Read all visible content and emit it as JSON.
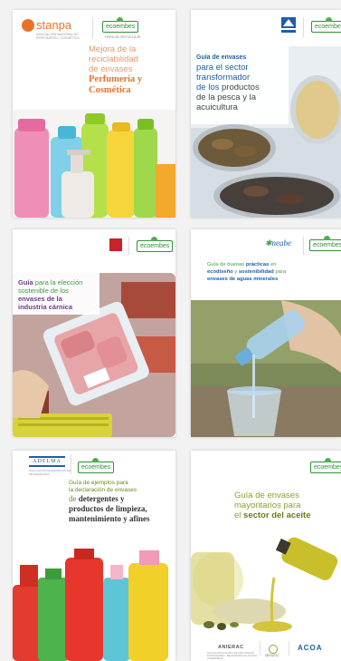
{
  "logos": {
    "ecoembes": "ecoembes",
    "ecoembes_sub": "PARA EL RECICLAJE",
    "stanpa": "stanpa",
    "stanpa_sub": "ASOCIACIÓN NACIONAL DE PERFUMERÍA Y COSMÉTICA",
    "neabe": "neabe",
    "adelma": "ADELMA",
    "adelma_sub": "ASOCIACIÓN DE EMPRESAS DE DETERGENTES",
    "anierac": "ANIERAC",
    "anierac_sub": "ASOCIACIÓN NACIONAL DE INDUSTRIALES ENVASADORES Y REFINADORES DE ACEITES COMESTIBLES",
    "deoleo": "DEOLEO",
    "acoa": "ACOA"
  },
  "covers": [
    {
      "title_line1": "Mejora de la",
      "title_line2": "reciclabilidad",
      "title_line3": "de envases",
      "title_highlight1": "Perfumería y",
      "title_highlight2": "Cosmética"
    },
    {
      "title_line1": "Guía de envases",
      "title_line2": "para el sector",
      "title_line3": "transformador",
      "title_line4a": "de los",
      "title_line4b": "productos",
      "title_line5": "de la pesca y la",
      "title_line6": "acuicultura"
    },
    {
      "title_line1a": "Guía",
      "title_line1b": "para la elección",
      "title_line2": "sostenible de los",
      "title_line3": "envases de la",
      "title_line4": "industria cárnica"
    },
    {
      "title_line1a": "Guía de buenas",
      "title_line1b": "prácticas",
      "title_line1c": "en",
      "title_line2a": "ecodiseño",
      "title_line2b": "y",
      "title_line2c": "sostenibilidad",
      "title_line2d": "para",
      "title_line3": "envases de aguas minerales"
    },
    {
      "title_line1": "Guía de ejemplos para",
      "title_line2": "la declaración de envases",
      "title_line3a": "de",
      "title_line3b": "detergentes y",
      "title_line4": "productos de limpieza,",
      "title_line5": "mantenimiento y afines"
    },
    {
      "title_line1": "Guía de envases",
      "title_line2": "mayoritarios para",
      "title_line3a": "el",
      "title_line3b": "sector del aceite"
    }
  ],
  "colors": {
    "orange": "#e8742b",
    "blue_band": "#2a5b9b",
    "green_text": "#2f8f38",
    "purple": "#6b3d8f",
    "blue_text": "#1f5ea8",
    "olive": "#6a8a1f"
  }
}
